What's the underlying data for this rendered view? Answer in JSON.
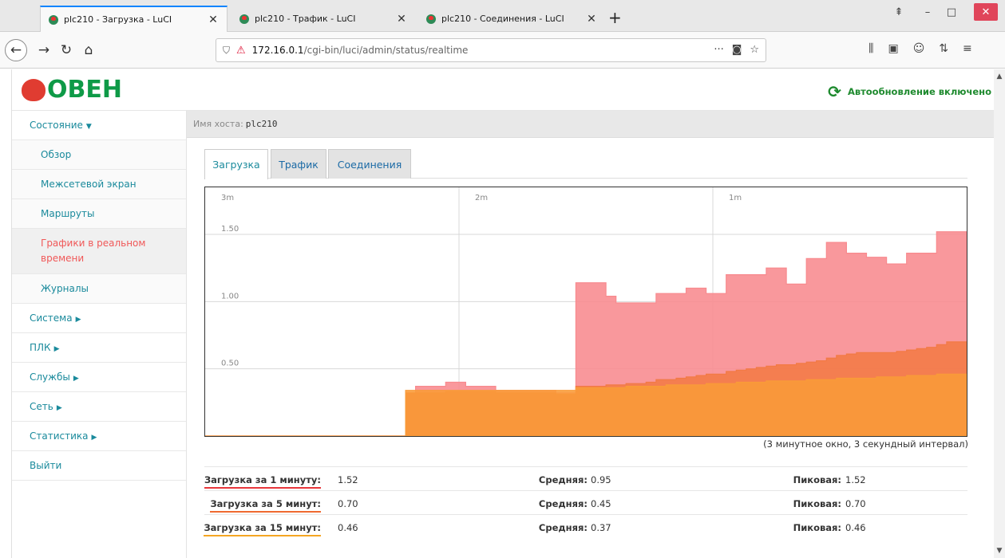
{
  "browser": {
    "tabs": [
      {
        "title": "plc210 - Загрузка - LuCI",
        "active": true
      },
      {
        "title": "plc210 - Трафик - LuCI",
        "active": false
      },
      {
        "title": "plc210 - Соединения - LuCI",
        "active": false
      }
    ],
    "url_host": "172.16.0.1",
    "url_path": "/cgi-bin/luci/admin/status/realtime"
  },
  "header": {
    "logo_text": "ОВЕН",
    "autorefresh_label": "Автообновление включено"
  },
  "sidebar": {
    "items": [
      {
        "label": "Состояние",
        "caret": "▼",
        "sub": false,
        "active": false
      },
      {
        "label": "Обзор",
        "caret": "",
        "sub": true,
        "active": false
      },
      {
        "label": "Межсетевой экран",
        "caret": "",
        "sub": true,
        "active": false
      },
      {
        "label": "Маршруты",
        "caret": "",
        "sub": true,
        "active": false
      },
      {
        "label": "Графики в реальном времени",
        "caret": "",
        "sub": true,
        "active": true
      },
      {
        "label": "Журналы",
        "caret": "",
        "sub": true,
        "active": false
      },
      {
        "label": "Система",
        "caret": "▶",
        "sub": false,
        "active": false
      },
      {
        "label": "ПЛК",
        "caret": "▶",
        "sub": false,
        "active": false
      },
      {
        "label": "Службы",
        "caret": "▶",
        "sub": false,
        "active": false
      },
      {
        "label": "Сеть",
        "caret": "▶",
        "sub": false,
        "active": false
      },
      {
        "label": "Статистика",
        "caret": "▶",
        "sub": false,
        "active": false
      },
      {
        "label": "Выйти",
        "caret": "",
        "sub": false,
        "active": false
      }
    ]
  },
  "main": {
    "hostname_label": "Имя хоста:",
    "hostname_value": "plc210",
    "tabs": [
      {
        "label": "Загрузка",
        "active": true
      },
      {
        "label": "Трафик",
        "active": false
      },
      {
        "label": "Соединения",
        "active": false
      }
    ],
    "chart_note": "(3 минутное окно, 3 секундный интервал)",
    "stats": [
      {
        "label": "Загрузка за 1 минуту:",
        "value": "1.52",
        "avg_label": "Средняя:",
        "avg": "0.95",
        "peak_label": "Пиковая:",
        "peak": "1.52",
        "color": "#e8363b"
      },
      {
        "label": "Загрузка за 5 минут:",
        "value": "0.70",
        "avg_label": "Средняя:",
        "avg": "0.45",
        "peak_label": "Пиковая:",
        "peak": "0.70",
        "color": "#f06a30"
      },
      {
        "label": "Загрузка за 15 минут:",
        "value": "0.46",
        "avg_label": "Средняя:",
        "avg": "0.37",
        "peak_label": "Пиковая:",
        "peak": "0.46",
        "color": "#f5a623"
      }
    ]
  },
  "chart_data": {
    "type": "area",
    "x_tick_labels": [
      "3m",
      "2m",
      "1m"
    ],
    "x_tick_positions": [
      180,
      120,
      60
    ],
    "y_tick_labels": [
      "1.50",
      "1.00",
      "0.50"
    ],
    "y_ticks": [
      1.5,
      1.0,
      0.5
    ],
    "xlim": [
      180,
      0
    ],
    "ylim": [
      0,
      1.85
    ],
    "grid": true,
    "series": [
      {
        "color": "#f88a8e",
        "values": [
          0,
          0,
          0,
          0,
          0,
          0,
          0,
          0,
          0,
          0,
          0,
          0,
          0,
          0,
          0,
          0,
          0,
          0,
          0,
          0,
          0.32,
          0.37,
          0.37,
          0.37,
          0.4,
          0.4,
          0.37,
          0.37,
          0.37,
          0.34,
          0.34,
          0.34,
          0.34,
          0.34,
          0.34,
          0.32,
          0.32,
          1.14,
          1.14,
          1.14,
          1.04,
          0.99,
          0.99,
          0.99,
          0.99,
          1.06,
          1.06,
          1.06,
          1.1,
          1.1,
          1.06,
          1.06,
          1.2,
          1.2,
          1.2,
          1.2,
          1.25,
          1.25,
          1.13,
          1.13,
          1.32,
          1.32,
          1.44,
          1.44,
          1.36,
          1.36,
          1.33,
          1.33,
          1.28,
          1.28,
          1.36,
          1.36,
          1.36,
          1.52,
          1.52,
          1.52
        ]
      },
      {
        "color": "#f27a45",
        "values": [
          0,
          0,
          0,
          0,
          0,
          0,
          0,
          0,
          0,
          0,
          0,
          0,
          0,
          0,
          0,
          0,
          0,
          0,
          0,
          0,
          0.32,
          0.32,
          0.32,
          0.32,
          0.33,
          0.33,
          0.33,
          0.33,
          0.33,
          0.32,
          0.32,
          0.32,
          0.32,
          0.32,
          0.32,
          0.31,
          0.31,
          0.37,
          0.37,
          0.37,
          0.38,
          0.38,
          0.39,
          0.39,
          0.4,
          0.42,
          0.42,
          0.43,
          0.44,
          0.45,
          0.46,
          0.46,
          0.48,
          0.49,
          0.5,
          0.51,
          0.52,
          0.53,
          0.53,
          0.54,
          0.55,
          0.56,
          0.58,
          0.6,
          0.61,
          0.62,
          0.62,
          0.62,
          0.62,
          0.63,
          0.64,
          0.65,
          0.66,
          0.68,
          0.7,
          0.7
        ]
      },
      {
        "color": "#f99b38",
        "values": [
          0,
          0,
          0,
          0,
          0,
          0,
          0,
          0,
          0,
          0,
          0,
          0,
          0,
          0,
          0,
          0,
          0,
          0,
          0,
          0,
          0.34,
          0.34,
          0.34,
          0.34,
          0.34,
          0.34,
          0.34,
          0.34,
          0.34,
          0.34,
          0.34,
          0.34,
          0.34,
          0.34,
          0.34,
          0.34,
          0.34,
          0.36,
          0.36,
          0.36,
          0.36,
          0.36,
          0.37,
          0.37,
          0.37,
          0.37,
          0.38,
          0.38,
          0.38,
          0.38,
          0.39,
          0.39,
          0.39,
          0.4,
          0.4,
          0.4,
          0.41,
          0.41,
          0.41,
          0.41,
          0.42,
          0.42,
          0.42,
          0.43,
          0.43,
          0.43,
          0.43,
          0.44,
          0.44,
          0.44,
          0.45,
          0.45,
          0.45,
          0.46,
          0.46,
          0.46
        ]
      }
    ]
  }
}
